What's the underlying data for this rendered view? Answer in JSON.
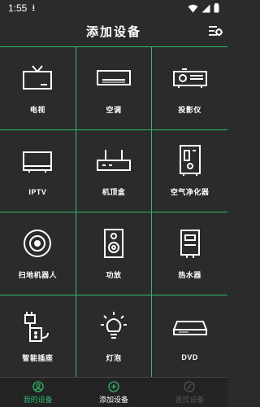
{
  "status_bar": {
    "time": "1:55"
  },
  "header": {
    "title": "添加设备"
  },
  "devices": [
    {
      "label": "电视",
      "icon": "tv-icon"
    },
    {
      "label": "空调",
      "icon": "air-conditioner-icon"
    },
    {
      "label": "投影仪",
      "icon": "projector-icon"
    },
    {
      "label": "IPTV",
      "icon": "iptv-icon"
    },
    {
      "label": "机顶盒",
      "icon": "set-top-box-icon"
    },
    {
      "label": "空气净化器",
      "icon": "air-purifier-icon"
    },
    {
      "label": "扫地机器人",
      "icon": "robot-vacuum-icon"
    },
    {
      "label": "功放",
      "icon": "speaker-icon"
    },
    {
      "label": "热水器",
      "icon": "water-heater-icon"
    },
    {
      "label": "智能插座",
      "icon": "smart-socket-icon"
    },
    {
      "label": "灯泡",
      "icon": "light-bulb-icon"
    },
    {
      "label": "DVD",
      "icon": "dvd-icon"
    }
  ],
  "tabs": [
    {
      "label": "我的设备",
      "color": "#2fb86e"
    },
    {
      "label": "添加设备",
      "color": "#ffffff"
    },
    {
      "label": "遥控设备",
      "color": "#555555"
    }
  ],
  "colors": {
    "accent": "#2fb86e",
    "background": "#2b2b2b"
  }
}
